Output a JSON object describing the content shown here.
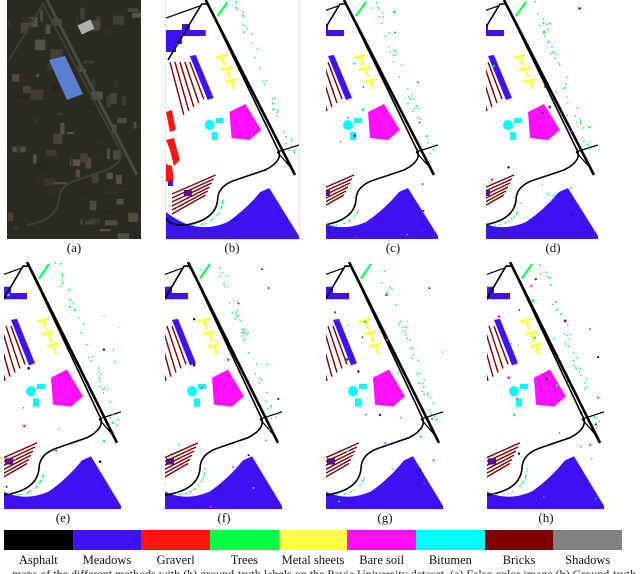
{
  "figure": {
    "panels": [
      {
        "id": "a",
        "label": "(a)",
        "kind": "false-color-image"
      },
      {
        "id": "b",
        "label": "(b)",
        "kind": "ground-truth-map"
      },
      {
        "id": "c",
        "label": "(c)",
        "kind": "classification-map"
      },
      {
        "id": "d",
        "label": "(d)",
        "kind": "classification-map"
      },
      {
        "id": "e",
        "label": "(e)",
        "kind": "classification-map"
      },
      {
        "id": "f",
        "label": "(f)",
        "kind": "classification-map"
      },
      {
        "id": "g",
        "label": "(g)",
        "kind": "classification-map"
      },
      {
        "id": "h",
        "label": "(h)",
        "kind": "classification-map"
      }
    ],
    "legend": [
      {
        "name": "Asphalt",
        "color": "#000000"
      },
      {
        "name": "Meadows",
        "color": "#3f12f5"
      },
      {
        "name": "Graverl",
        "color": "#ff1410"
      },
      {
        "name": "Trees",
        "color": "#00ff46"
      },
      {
        "name": "Metal sheets",
        "color": "#ffff46"
      },
      {
        "name": "Bare soil",
        "color": "#ff10ff"
      },
      {
        "name": "Bitumen",
        "color": "#00ffff"
      },
      {
        "name": "Bricks",
        "color": "#7d0000"
      },
      {
        "name": "Shadows",
        "color": "#828282"
      }
    ],
    "caption_partial": "…maps of the different methods with (b) ground-truth labels on the Pavia University dataset. (a) False-color image (b) Ground-truth…"
  }
}
